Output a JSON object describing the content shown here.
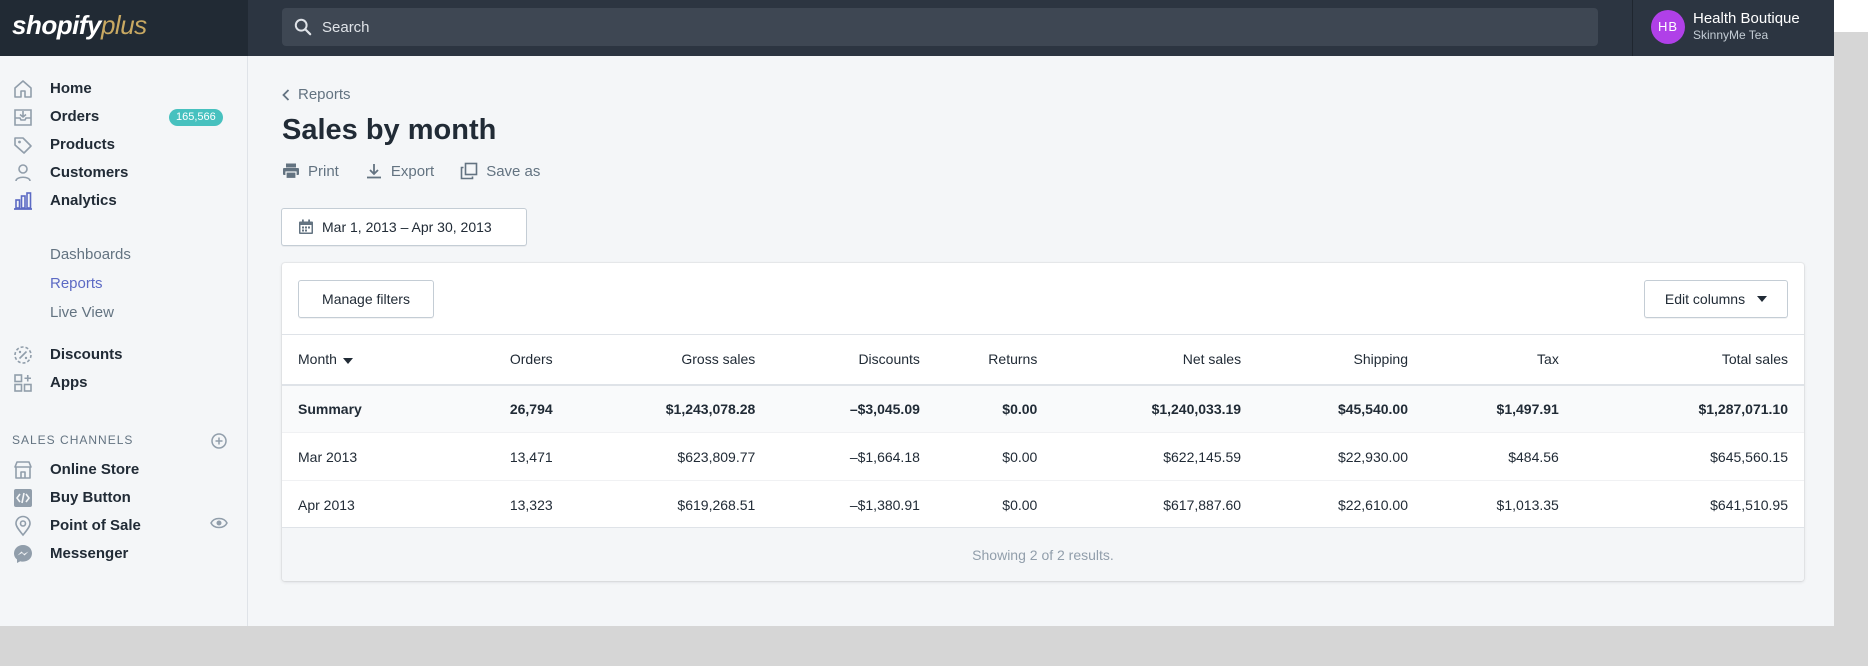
{
  "brand": {
    "part1": "shopify",
    "part2": "plus"
  },
  "search": {
    "placeholder": "Search"
  },
  "account": {
    "initials": "HB",
    "name": "Health Boutique",
    "store": "SkinnyMe Tea"
  },
  "sidebar": {
    "items": [
      {
        "label": "Home",
        "icon": "home-icon"
      },
      {
        "label": "Orders",
        "icon": "orders-icon",
        "badge": "165,566"
      },
      {
        "label": "Products",
        "icon": "tag-icon"
      },
      {
        "label": "Customers",
        "icon": "person-icon"
      },
      {
        "label": "Analytics",
        "icon": "analytics-icon"
      }
    ],
    "analytics_sub": [
      {
        "label": "Dashboards"
      },
      {
        "label": "Reports",
        "active": true
      },
      {
        "label": "Live View"
      }
    ],
    "items2": [
      {
        "label": "Discounts",
        "icon": "discount-icon"
      },
      {
        "label": "Apps",
        "icon": "apps-icon"
      }
    ],
    "channels_heading": "SALES CHANNELS",
    "channels": [
      {
        "label": "Online Store",
        "icon": "store-icon"
      },
      {
        "label": "Buy Button",
        "icon": "code-icon"
      },
      {
        "label": "Point of Sale",
        "icon": "location-icon"
      },
      {
        "label": "Messenger",
        "icon": "messenger-icon"
      }
    ]
  },
  "page": {
    "breadcrumb": "Reports",
    "title": "Sales by month",
    "actions": {
      "print": "Print",
      "export": "Export",
      "save_as": "Save as"
    },
    "date_range": "Mar 1, 2013 – Apr 30, 2013"
  },
  "report": {
    "manage_filters": "Manage filters",
    "edit_columns": "Edit columns",
    "columns": [
      "Month",
      "Orders",
      "Gross sales",
      "Discounts",
      "Returns",
      "Net sales",
      "Shipping",
      "Tax",
      "Total sales"
    ],
    "summary": [
      "Summary",
      "26,794",
      "$1,243,078.28",
      "–$3,045.09",
      "$0.00",
      "$1,240,033.19",
      "$45,540.00",
      "$1,497.91",
      "$1,287,071.10"
    ],
    "rows": [
      [
        "Mar 2013",
        "13,471",
        "$623,809.77",
        "–$1,664.18",
        "$0.00",
        "$622,145.59",
        "$22,930.00",
        "$484.56",
        "$645,560.15"
      ],
      [
        "Apr 2013",
        "13,323",
        "$619,268.51",
        "–$1,380.91",
        "$0.00",
        "$617,887.60",
        "$22,610.00",
        "$1,013.35",
        "$641,510.95"
      ]
    ],
    "footer": "Showing 2 of 2 results."
  },
  "colors": {
    "topbar": "#2c3541",
    "accent": "#5c6ac4",
    "badge": "#47c1bf",
    "avatar": "#b040e8"
  }
}
